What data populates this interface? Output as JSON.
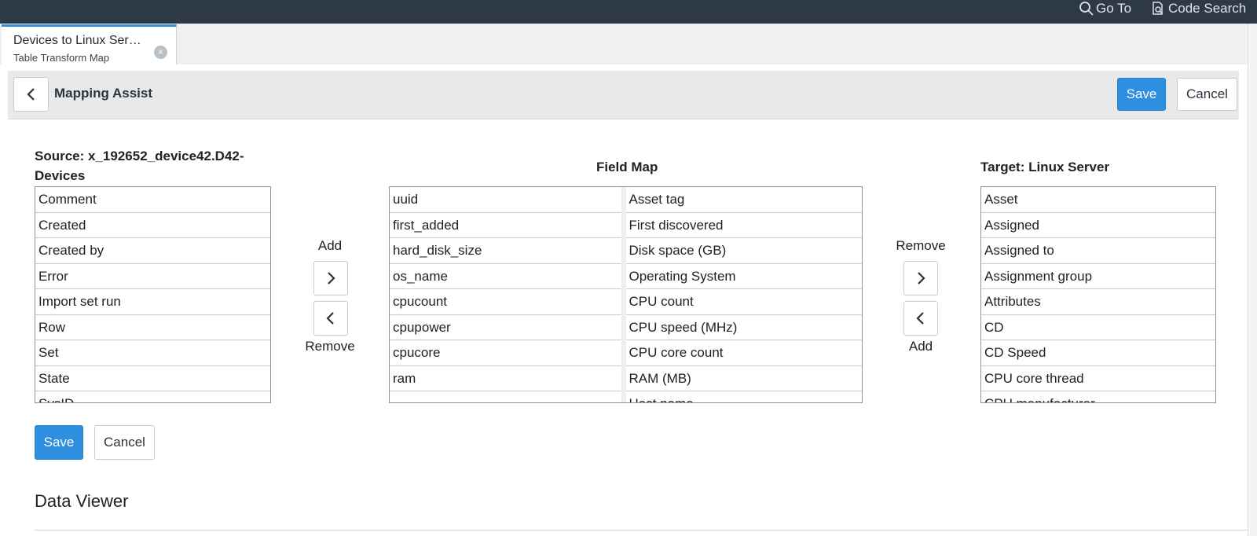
{
  "topbar": {
    "goto_label": "Go To",
    "code_search_label": "Code Search",
    "background": "#2d3a46"
  },
  "tab": {
    "title": "Devices to Linux Ser…",
    "subtitle": "Table Transform Map",
    "close_glyph": "×"
  },
  "header": {
    "title": "Mapping Assist",
    "save_label": "Save",
    "cancel_label": "Cancel"
  },
  "source": {
    "label": "Source: x_192652_device42.D42-Devices",
    "items": [
      "Comment",
      "Created",
      "Created by",
      "Error",
      "Import set run",
      "Row",
      "Set",
      "State",
      "SysID"
    ]
  },
  "field_map": {
    "label": "Field Map",
    "source_fields": [
      "uuid",
      "first_added",
      "hard_disk_size",
      "os_name",
      "cpucount",
      "cpupower",
      "cpucore",
      "ram",
      ""
    ],
    "target_fields": [
      "Asset tag",
      "First discovered",
      "Disk space (GB)",
      "Operating System",
      "CPU count",
      "CPU speed (MHz)",
      "CPU core count",
      "RAM (MB)",
      "Host name"
    ]
  },
  "left_controls": {
    "add_label": "Add",
    "remove_label": "Remove"
  },
  "right_controls": {
    "remove_label": "Remove",
    "add_label": "Add"
  },
  "target": {
    "label": "Target: Linux Server",
    "items": [
      "Asset",
      "Assigned",
      "Assigned to",
      "Assignment group",
      "Attributes",
      "CD",
      "CD Speed",
      "CPU core thread",
      "CPU manufacturer"
    ]
  },
  "footer": {
    "save_label": "Save",
    "cancel_label": "Cancel"
  },
  "data_viewer": {
    "title": "Data Viewer"
  },
  "colors": {
    "primary": "#2e8ee0",
    "tab_accent": "#2e8ee0",
    "header_bg": "#e7e9eb"
  }
}
